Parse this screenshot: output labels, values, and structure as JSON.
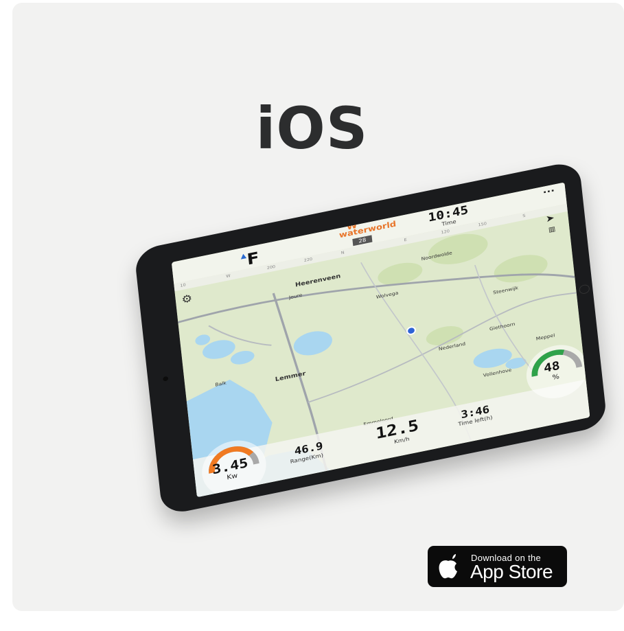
{
  "page": {
    "title": "iOS"
  },
  "app": {
    "logo_text": "waterworld",
    "logo_mark": "W",
    "heading": "28",
    "time": "10:45",
    "time_label": "Time",
    "menu_icon": "more-dots-icon",
    "wind_letter": "F",
    "scale_ticks": [
      "10",
      "W",
      "200",
      "220",
      "N",
      "E",
      "120",
      "150",
      "S"
    ],
    "places": [
      {
        "name": "Heerenveen",
        "big": true
      },
      {
        "name": "Joure",
        "big": false
      },
      {
        "name": "Noordwolde",
        "big": false
      },
      {
        "name": "Wolvega",
        "big": false
      },
      {
        "name": "Steenwijk",
        "big": false
      },
      {
        "name": "Balk",
        "big": false
      },
      {
        "name": "Lemmer",
        "big": false
      },
      {
        "name": "Nederland",
        "big": false
      },
      {
        "name": "Giethoorn",
        "big": false
      },
      {
        "name": "Meppel",
        "big": false
      },
      {
        "name": "Emmeloord",
        "big": false
      },
      {
        "name": "Vollenhove",
        "big": false
      }
    ],
    "gauges": {
      "power_value": "3.45",
      "power_unit": "Kw",
      "power_level": 0.62,
      "range_value": "46.9",
      "range_label": "Range(Km)",
      "speed_value": "12.5",
      "speed_unit": "Km/h",
      "time_left_value": "3:46",
      "time_left_label": "Time left(h)",
      "battery_value": "48",
      "battery_unit": "%",
      "battery_level": 0.48
    },
    "colors": {
      "power_arc": "#f07a22",
      "battery_arc": "#2fa24a",
      "location": "#2e63d6",
      "water": "#a9d6f0",
      "land": "#dfe9cc"
    }
  },
  "badge": {
    "small_text": "Download on the",
    "big_text": "App Store",
    "icon": "apple-logo-icon"
  }
}
